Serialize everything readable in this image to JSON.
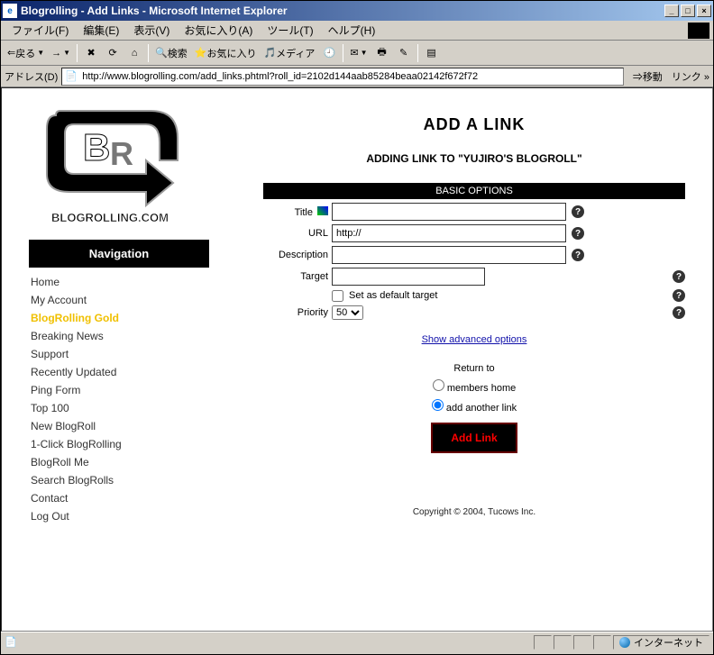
{
  "window": {
    "title": "Blogrolling - Add Links - Microsoft Internet Explorer"
  },
  "titlebar_buttons": {
    "min": "_",
    "max": "□",
    "close": "×"
  },
  "menu": {
    "file": "ファイル(F)",
    "edit": "編集(E)",
    "view": "表示(V)",
    "favorites": "お気に入り(A)",
    "tools": "ツール(T)",
    "help": "ヘルプ(H)"
  },
  "toolbar": {
    "back": "戻る",
    "search": "検索",
    "favorites": "お気に入り",
    "media": "メディア"
  },
  "address": {
    "label": "アドレス(D)",
    "url": "http://www.blogrolling.com/add_links.phtml?roll_id=2102d144aab85284beaa02142f672f72",
    "go": "移動",
    "links": "リンク"
  },
  "sidebar": {
    "logo_text": "BLOGROLLING.COM",
    "nav_title": "Navigation",
    "items": [
      {
        "label": "Home",
        "gold": false
      },
      {
        "label": "My Account",
        "gold": false
      },
      {
        "label": "BlogRolling Gold",
        "gold": true
      },
      {
        "label": "Breaking News",
        "gold": false
      },
      {
        "label": "Support",
        "gold": false
      },
      {
        "label": "Recently Updated",
        "gold": false
      },
      {
        "label": "Ping Form",
        "gold": false
      },
      {
        "label": "Top 100",
        "gold": false
      },
      {
        "label": "New BlogRoll",
        "gold": false
      },
      {
        "label": "1-Click BlogRolling",
        "gold": false
      },
      {
        "label": "BlogRoll Me",
        "gold": false
      },
      {
        "label": "Search BlogRolls",
        "gold": false
      },
      {
        "label": "Contact",
        "gold": false
      },
      {
        "label": "Log Out",
        "gold": false
      }
    ]
  },
  "main": {
    "h1": "ADD A LINK",
    "h2": "ADDING LINK TO \"YUJIRO'S BLOGROLL\"",
    "section": "BASIC OPTIONS",
    "fields": {
      "title_label": "Title",
      "title_value": "",
      "url_label": "URL",
      "url_value": "http://",
      "desc_label": "Description",
      "desc_value": "",
      "target_label": "Target",
      "target_value": "",
      "default_target": "Set as default target",
      "priority_label": "Priority",
      "priority_value": "50"
    },
    "adv_link": "Show advanced options",
    "return_to": "Return to",
    "radio_home": "members home",
    "radio_another": "add another link",
    "submit": "Add Link"
  },
  "footer": "Copyright © 2004, Tucows Inc.",
  "status": {
    "zone": "インターネット"
  }
}
